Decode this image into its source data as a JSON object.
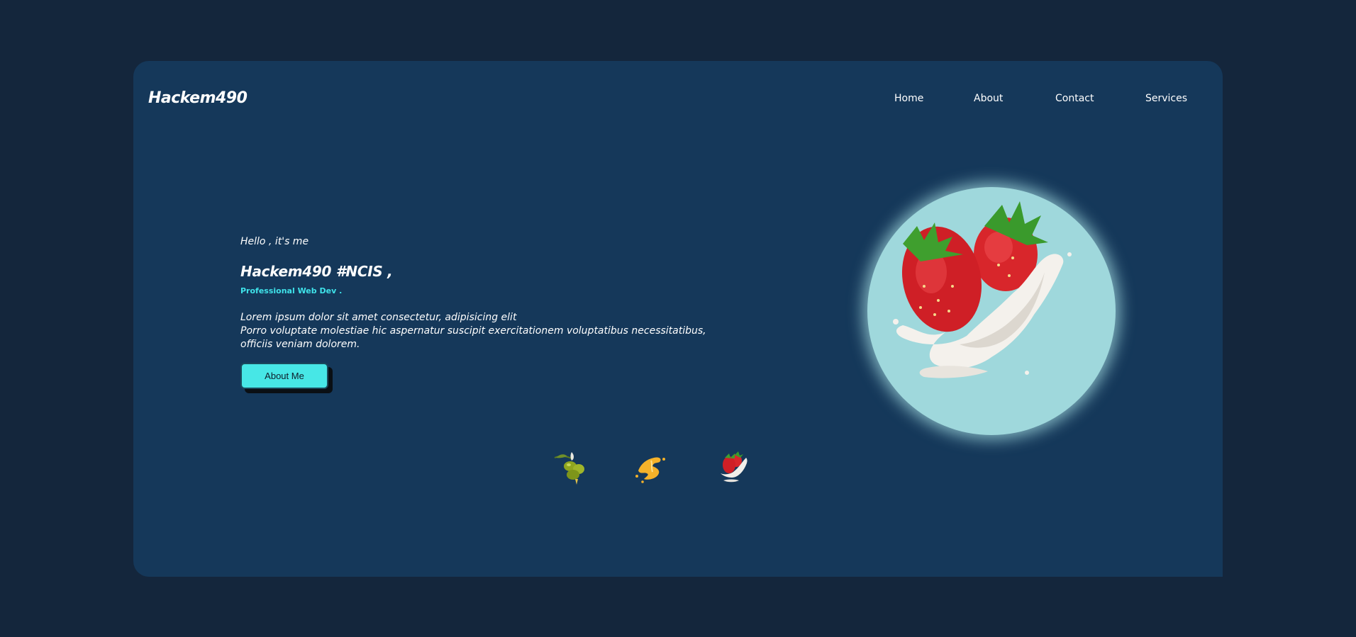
{
  "header": {
    "logo": "Hackem490",
    "nav": [
      "Home",
      "About",
      "Contact",
      "Services"
    ]
  },
  "hero": {
    "greeting": "Hello , it's me",
    "name": "Hackem490 #NCIS ,",
    "role": "Professional Web Dev .",
    "description": [
      "Lorem ipsum dolor sit amet consectetur, adipisicing elit",
      "Porro voluptate molestiae hic aspernatur suscipit exercitationem voluptatibus necessitatibus,",
      "officiis veniam dolorem."
    ],
    "button": "About Me"
  },
  "thumbnails": [
    {
      "icon": "olive-icon"
    },
    {
      "icon": "orange-splash-icon"
    },
    {
      "icon": "strawberry-milk-icon"
    }
  ],
  "colors": {
    "page_background": "#14263c",
    "card_background": "#15385a",
    "accent": "#3fe3ea",
    "button_background": "#47e7e6",
    "circle_background": "#9fd8dc"
  }
}
